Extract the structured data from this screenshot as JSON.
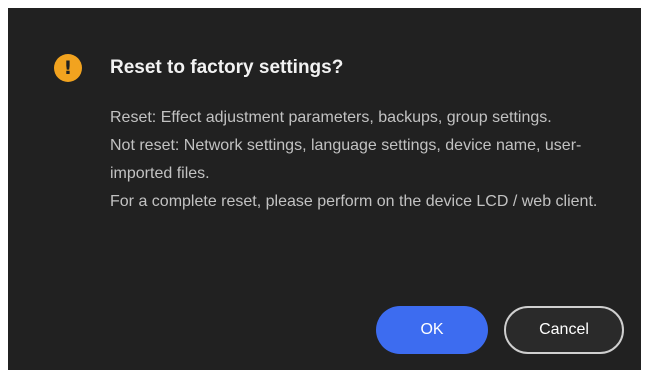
{
  "dialog": {
    "icon": "warning-icon",
    "icon_glyph": "!",
    "title": "Reset to factory settings?",
    "lines": [
      "Reset: Effect adjustment parameters, backups, group settings.",
      "Not reset: Network settings, language settings, device name, user-imported files.",
      "For a complete reset, please perform on the device LCD / web client."
    ],
    "ok_label": "OK",
    "cancel_label": "Cancel"
  },
  "colors": {
    "background": "#212121",
    "warning": "#f2a31f",
    "primary": "#3d6cf0"
  }
}
